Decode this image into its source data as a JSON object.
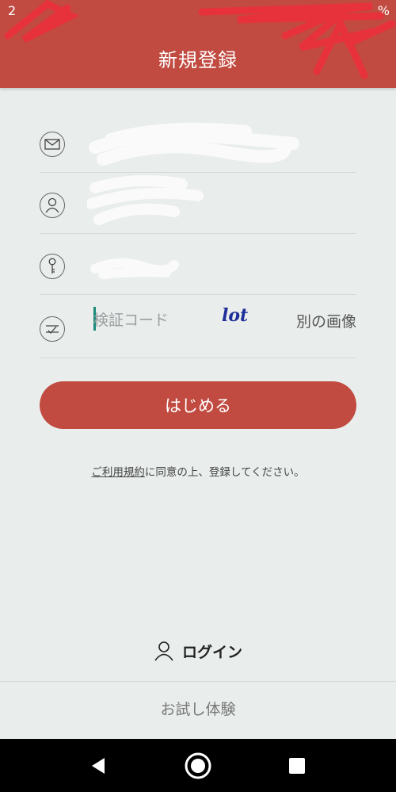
{
  "status": {
    "time": "2",
    "battery": "%"
  },
  "header": {
    "title": "新規登録"
  },
  "form": {
    "email_icon": "mail-icon",
    "user_icon": "person-icon",
    "key_icon": "key-icon",
    "captcha_icon": "captcha-icon",
    "captcha_placeholder": "検証コード",
    "captcha_image_text": "lot",
    "refresh_label": "別の画像"
  },
  "actions": {
    "start_label": "はじめる",
    "agreement_link": "ご利用規約",
    "agreement_rest": "に同意の上、登録してください。",
    "login_label": "ログイン",
    "trial_label": "お試し体験"
  },
  "colors": {
    "brand": "#c14b41",
    "background": "#e9edec",
    "captcha_text": "#1f2f9a"
  }
}
